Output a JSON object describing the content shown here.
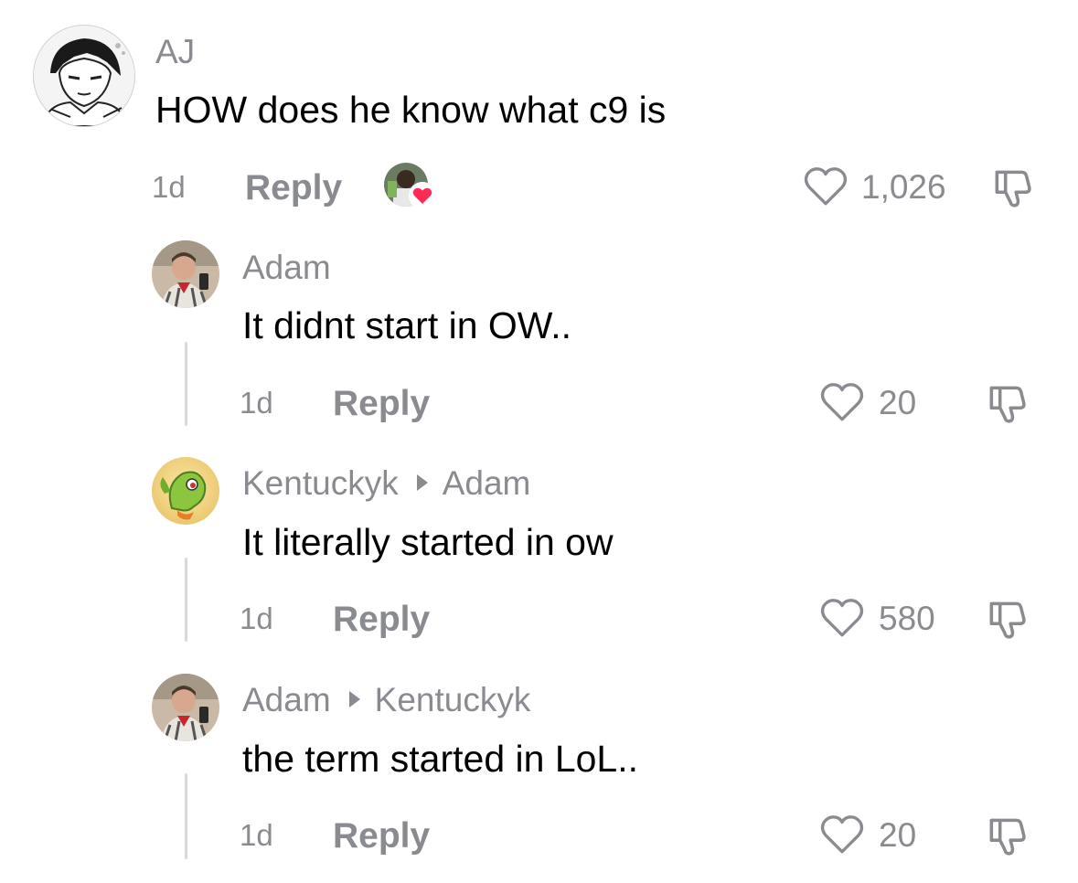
{
  "comments": [
    {
      "author": "AJ",
      "text": "HOW does he know what c9 is",
      "time": "1d",
      "reply_label": "Reply",
      "likes": "1,026",
      "creator_liked": true
    },
    {
      "author": "Adam",
      "text": "It didnt start in OW..",
      "time": "1d",
      "reply_label": "Reply",
      "likes": "20"
    },
    {
      "author": "Kentuckyk",
      "reply_to": "Adam",
      "text": "It literally started in ow",
      "time": "1d",
      "reply_label": "Reply",
      "likes": "580"
    },
    {
      "author": "Adam",
      "reply_to": "Kentuckyk",
      "text": "the term started in LoL..",
      "time": "1d",
      "reply_label": "Reply",
      "likes": "20"
    }
  ],
  "icons": {
    "like": "heart-outline-icon",
    "dislike": "thumbs-down-icon",
    "creator_like_badge": "heart-badge-icon"
  },
  "colors": {
    "muted_text": "#8a8b91",
    "body_text": "#000000",
    "heart_badge": "#fe2c55",
    "thread_line": "#d8d8dc"
  }
}
